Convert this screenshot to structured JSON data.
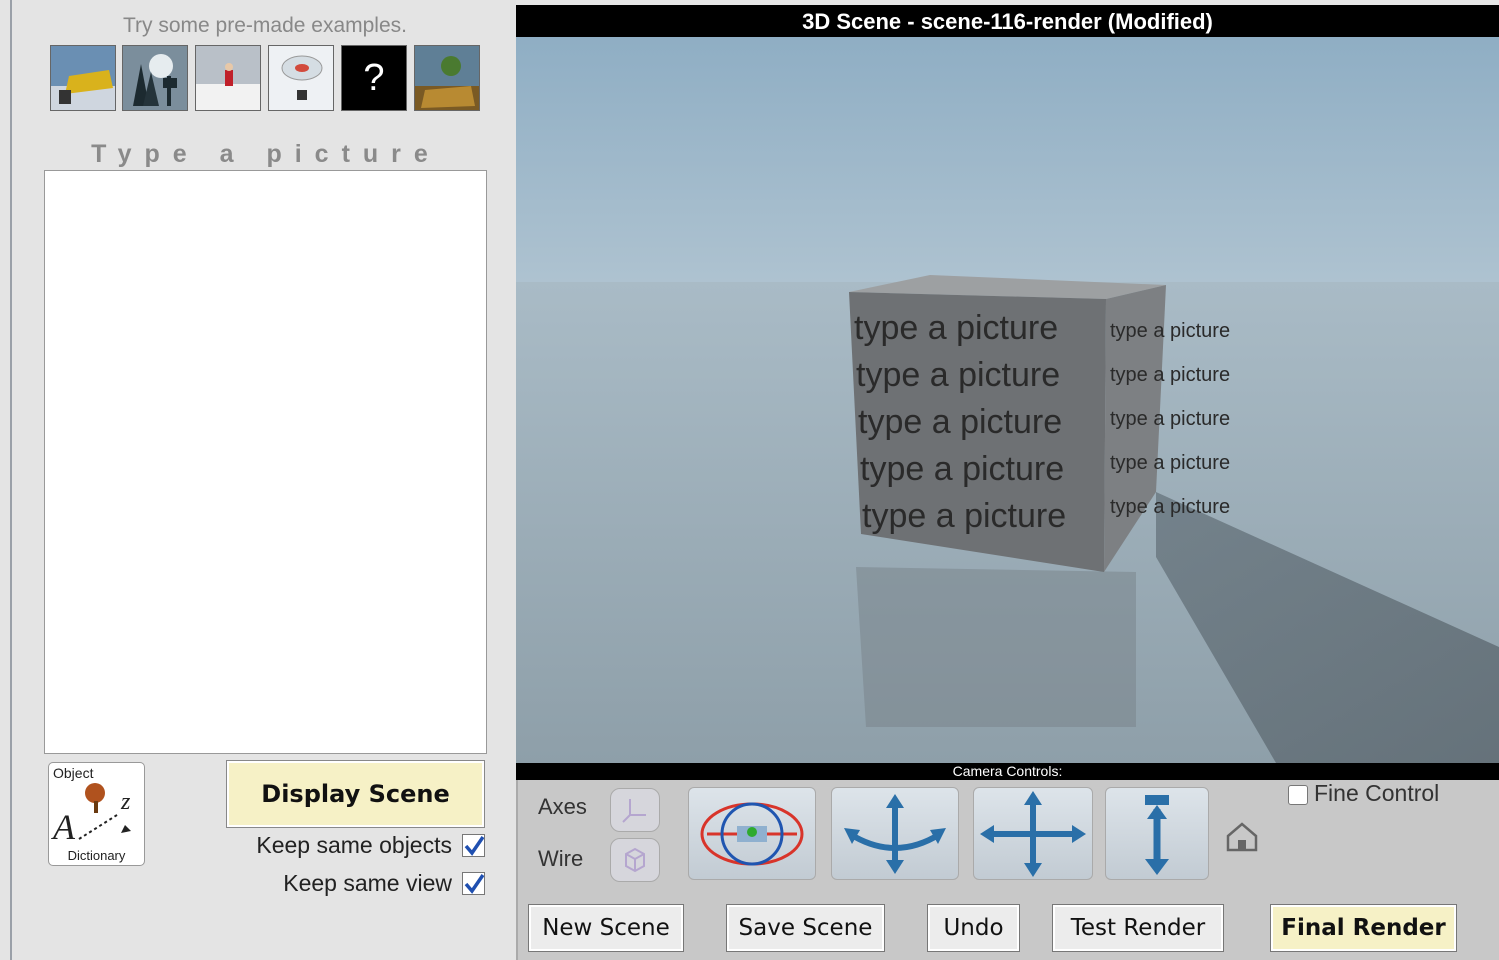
{
  "sidebar": {
    "examples_title": "Try some pre-made examples.",
    "example_thumbnails": [
      "example-bulldozer",
      "example-trees-deer",
      "example-santa-snow",
      "example-fish-bowl",
      "?",
      "example-tree-box"
    ],
    "type_picture_title": "Type a picture",
    "picture_input_value": "",
    "dictionary": {
      "top_label": "Object",
      "bottom_label": "Dictionary"
    },
    "display_scene_label": "Display Scene",
    "keep_same_objects_label": "Keep same objects",
    "keep_same_objects_checked": true,
    "keep_same_view_label": "Keep same view",
    "keep_same_view_checked": true
  },
  "scene": {
    "title": "3D Scene  -  scene-116-render (Modified)",
    "cube_text": "type a picture",
    "camera_controls_label": "Camera Controls:",
    "axes_label": "Axes",
    "wire_label": "Wire",
    "fine_control_label": "Fine Control",
    "fine_control_checked": false
  },
  "toolbar": {
    "new_scene": "New Scene",
    "save_scene": "Save Scene",
    "undo": "Undo",
    "test_render": "Test Render",
    "final_render": "Final Render"
  },
  "colors": {
    "accent_button": "#f6f1c6",
    "title_bar": "#000000",
    "sky": "#95aebd",
    "control_icon": "#2a6fa8"
  }
}
